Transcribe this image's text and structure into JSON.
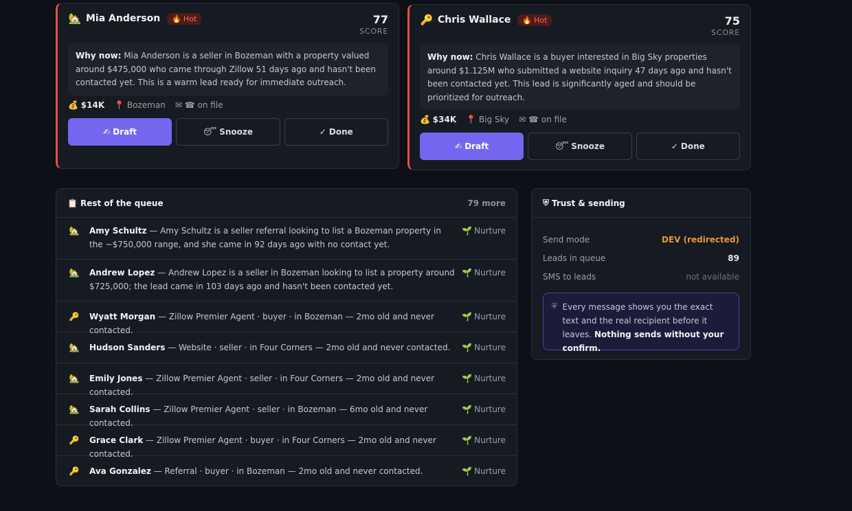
{
  "leads": [
    {
      "emoji": "🏡",
      "name": "Mia Anderson",
      "hot_icon": "🔥",
      "hot_label": "Hot",
      "score": "77",
      "score_label": "SCORE",
      "why_label": "Why now:",
      "why_text": "Mia Anderson is a seller in Bozeman with a property valued around $475,000 who came through Zillow 51 days ago and hasn't been contacted yet. This is a warm lead ready for immediate outreach.",
      "money_icon": "💰",
      "commission": "$14K",
      "pin_icon": "📍",
      "location": "Bozeman",
      "contact_icons": "✉ ☎",
      "contact_text": "on file",
      "draft_icon": "✍",
      "draft_label": "Draft",
      "snooze_icon": "😴",
      "snooze_label": "Snooze",
      "done_icon": "✓",
      "done_label": "Done"
    },
    {
      "emoji": "🔑",
      "name": "Chris Wallace",
      "hot_icon": "🔥",
      "hot_label": "Hot",
      "score": "75",
      "score_label": "SCORE",
      "why_label": "Why now:",
      "why_text": "Chris Wallace is a buyer interested in Big Sky properties around $1.125M who submitted a website inquiry 47 days ago and hasn't been contacted yet. This lead is significantly aged and should be prioritized for outreach.",
      "money_icon": "💰",
      "commission": "$34K",
      "pin_icon": "📍",
      "location": "Big Sky",
      "contact_icons": "✉ ☎",
      "contact_text": "on file",
      "draft_icon": "✍",
      "draft_label": "Draft",
      "snooze_icon": "😴",
      "snooze_label": "Snooze",
      "done_icon": "✓",
      "done_label": "Done"
    }
  ],
  "queue": {
    "icon": "📋",
    "title": "Rest of the queue",
    "more": "79 more",
    "tag_icon": "🌱",
    "rows": [
      {
        "emoji": "🏡",
        "name": "Amy Schultz",
        "text": " — Amy Schultz is a seller referral looking to list a Bozeman property in the ~$750,000 range, and she came in 92 days ago with no contact yet.",
        "tag": "Nurture"
      },
      {
        "emoji": "🏡",
        "name": "Andrew Lopez",
        "text": " — Andrew Lopez is a seller in Bozeman looking to list a property around $725,000; the lead came in 103 days ago and hasn't been contacted yet.",
        "tag": "Nurture"
      },
      {
        "emoji": "🔑",
        "name": "Wyatt Morgan",
        "text": " — Zillow Premier Agent · buyer · in Bozeman — 2mo old and never contacted.",
        "tag": "Nurture"
      },
      {
        "emoji": "🏡",
        "name": "Hudson Sanders",
        "text": " — Website · seller · in Four Corners — 2mo old and never contacted.",
        "tag": "Nurture"
      },
      {
        "emoji": "🏡",
        "name": "Emily Jones",
        "text": " — Zillow Premier Agent · seller · in Four Corners — 2mo old and never contacted.",
        "tag": "Nurture"
      },
      {
        "emoji": "🏡",
        "name": "Sarah Collins",
        "text": " — Zillow Premier Agent · seller · in Bozeman — 6mo old and never contacted.",
        "tag": "Nurture"
      },
      {
        "emoji": "🔑",
        "name": "Grace Clark",
        "text": " — Zillow Premier Agent · buyer · in Four Corners — 2mo old and never contacted.",
        "tag": "Nurture"
      },
      {
        "emoji": "🔑",
        "name": "Ava Gonzalez",
        "text": " — Referral · buyer · in Bozeman — 2mo old and never contacted.",
        "tag": "Nurture"
      }
    ]
  },
  "trust": {
    "icon": "⛨",
    "title": "Trust & sending",
    "send_mode_label": "Send mode",
    "send_mode_value": "DEV (redirected)",
    "leads_label": "Leads in queue",
    "leads_value": "89",
    "sms_label": "SMS to leads",
    "sms_value": "not available",
    "note_icon": "⛨",
    "note_text": "Every message shows you the exact text and the real recipient before it leaves.",
    "note_strong": "Nothing sends without your confirm."
  },
  "colors": {
    "accent": "#7367f0",
    "hot": "#ff6a4d",
    "warn": "#e89a2e",
    "background": "#0d1016",
    "card": "#161a22"
  }
}
